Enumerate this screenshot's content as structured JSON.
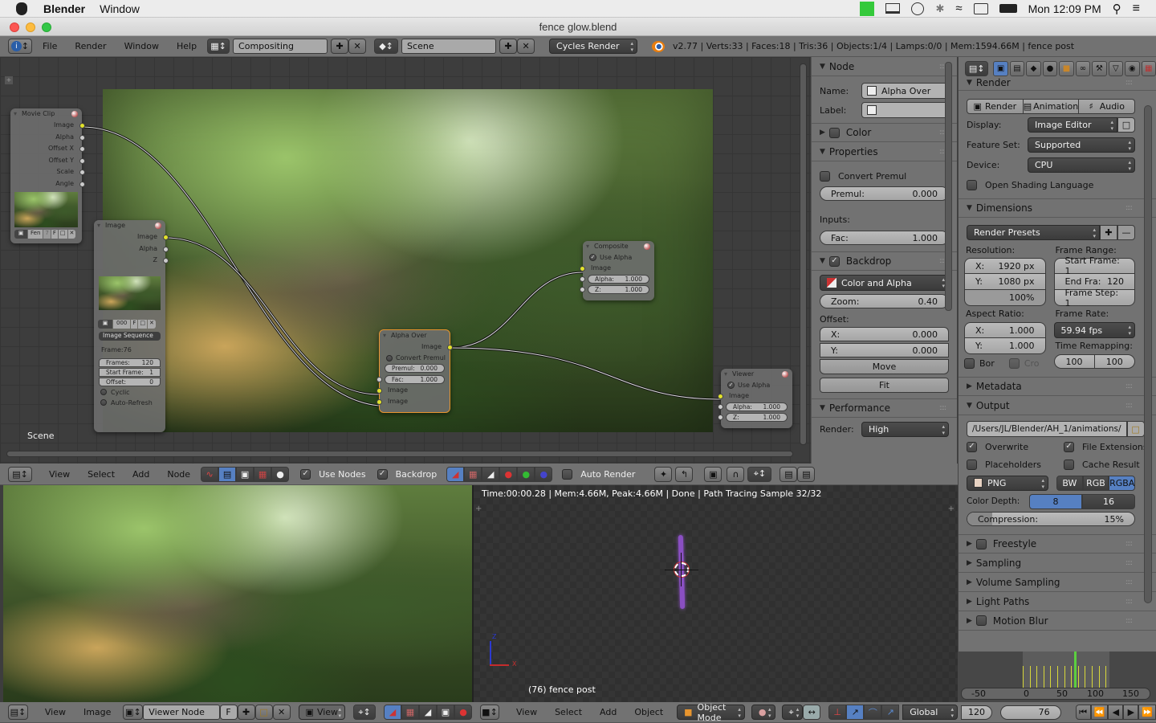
{
  "macos_menubar": {
    "app_name": "Blender",
    "menus": [
      "Window"
    ],
    "clock": "Mon 12:09 PM",
    "status_icons": [
      "app-status-icon",
      "airplay-icon",
      "time-machine-icon",
      "bluetooth-icon",
      "wifi-icon",
      "keyboard-viewer-icon",
      "battery-icon",
      "spotlight-icon",
      "notification-center-icon"
    ]
  },
  "window": {
    "title": "fence glow.blend"
  },
  "info_header": {
    "menus": [
      "File",
      "Render",
      "Window",
      "Help"
    ],
    "screen_layout": "Compositing",
    "scene": "Scene",
    "render_engine": "Cycles Render",
    "stats": "v2.77 | Verts:33 | Faces:18 | Tris:36 | Objects:1/4 | Lamps:0/0 | Mem:1594.66M | fence post"
  },
  "node_editor": {
    "scene_label": "Scene",
    "nodes": {
      "movie_clip": {
        "title": "Movie Clip",
        "outputs": [
          "Image",
          "Alpha",
          "Offset X",
          "Offset Y",
          "Scale",
          "Angle"
        ],
        "clip_name": "Fen",
        "users": "7",
        "fake_user": "F"
      },
      "image": {
        "title": "Image",
        "outputs": [
          "Image",
          "Alpha",
          "Z"
        ],
        "image_name": "000",
        "fake_user": "F",
        "source": "Image Sequence",
        "frame_info": "Frame:76",
        "frames_label": "Frames:",
        "frames_value": "120",
        "start_label": "Start Frame:",
        "start_value": "1",
        "offset_label": "Offset:",
        "offset_value": "0",
        "cyclic": "Cyclic",
        "auto_refresh": "Auto-Refresh"
      },
      "alpha_over": {
        "title": "Alpha Over",
        "output": "Image",
        "convert_premul": "Convert Premul",
        "premul_label": "Premul:",
        "premul_value": "0.000",
        "fac_label": "Fac:",
        "fac_value": "1.000",
        "inputs": [
          "Image",
          "Image"
        ]
      },
      "composite": {
        "title": "Composite",
        "use_alpha": "Use Alpha",
        "input": "Image",
        "alpha_label": "Alpha:",
        "alpha_value": "1.000",
        "z_label": "Z:",
        "z_value": "1.000"
      },
      "viewer": {
        "title": "Viewer",
        "use_alpha": "Use Alpha",
        "input": "Image",
        "alpha_label": "Alpha:",
        "alpha_value": "1.000",
        "z_label": "Z:",
        "z_value": "1.000"
      }
    },
    "header": {
      "menus": [
        "View",
        "Select",
        "Add",
        "Node"
      ],
      "use_nodes_label": "Use Nodes",
      "use_nodes_checked": true,
      "backdrop_label": "Backdrop",
      "backdrop_checked": true,
      "auto_render_label": "Auto Render",
      "auto_render_checked": false
    }
  },
  "node_panel": {
    "node_section": "Node",
    "name_label": "Name:",
    "name_value": "Alpha Over",
    "label_label": "Label:",
    "label_value": "",
    "color_section": "Color",
    "properties_section": "Properties",
    "convert_premul": "Convert Premul",
    "premul_label": "Premul:",
    "premul_value": "0.000",
    "inputs_label": "Inputs:",
    "fac_label": "Fac:",
    "fac_value": "1.000",
    "backdrop_section": "Backdrop",
    "backdrop_channels": "Color and Alpha",
    "zoom_label": "Zoom:",
    "zoom_value": "0.40",
    "offset_label": "Offset:",
    "offset_x_label": "X:",
    "offset_x_value": "0.000",
    "offset_y_label": "Y:",
    "offset_y_value": "0.000",
    "move_button": "Move",
    "fit_button": "Fit",
    "performance_section": "Performance",
    "render_label": "Render:",
    "render_value": "High"
  },
  "properties": {
    "render_section": "Render",
    "render_button": "Render",
    "animation_button": "Animation",
    "audio_button": "Audio",
    "display_label": "Display:",
    "display_value": "Image Editor",
    "feature_set_label": "Feature Set:",
    "feature_set_value": "Supported",
    "device_label": "Device:",
    "device_value": "CPU",
    "osl_label": "Open Shading Language",
    "dimensions_section": "Dimensions",
    "render_presets": "Render Presets",
    "resolution_label": "Resolution:",
    "res_x_label": "X:",
    "res_x_value": "1920 px",
    "res_y_label": "Y:",
    "res_y_value": "1080 px",
    "res_percent": "100%",
    "frame_range_label": "Frame Range:",
    "start_frame": "Start Frame: 1",
    "end_frame_label": "End Fra:",
    "end_frame_value": "120",
    "frame_step": "Frame Step: 1",
    "aspect_label": "Aspect Ratio:",
    "aspect_x_label": "X:",
    "aspect_x_value": "1.000",
    "aspect_y_label": "Y:",
    "aspect_y_value": "1.000",
    "border_label": "Bor",
    "crop_label": "Cro",
    "frame_rate_label": "Frame Rate:",
    "frame_rate_value": "59.94 fps",
    "time_remap_label": "Time Remapping:",
    "time_remap_old": "100",
    "time_remap_new": "100",
    "metadata_section": "Metadata",
    "output_section": "Output",
    "output_path": "/Users/JL/Blender/AH_1/animations/",
    "overwrite": "Overwrite",
    "file_extensions": "File Extensions",
    "placeholders": "Placeholders",
    "cache_result": "Cache Result",
    "file_format": "PNG",
    "color_modes": [
      "BW",
      "RGB",
      "RGBA"
    ],
    "color_mode_active": "RGBA",
    "color_depth_label": "Color Depth:",
    "color_depths": [
      "8",
      "16"
    ],
    "color_depth_active": "8",
    "compression_label": "Compression:",
    "compression_value": "15%",
    "compression_fraction": 0.15,
    "collapsed_sections": [
      "Freestyle",
      "Sampling",
      "Volume Sampling",
      "Light Paths",
      "Motion Blur"
    ]
  },
  "image_editor": {
    "menus": [
      "View",
      "Image"
    ],
    "image_name": "Viewer Node",
    "fake_user": "F",
    "view_mode": "View"
  },
  "viewport": {
    "render_info": "Time:00:00.28 | Mem:4.66M, Peak:4.66M | Done | Path Tracing Sample 32/32",
    "object_label": "(76) fence post",
    "axis_x": "X",
    "axis_z": "Z",
    "menus": [
      "View",
      "Select",
      "Add",
      "Object"
    ],
    "mode": "Object Mode",
    "orientation": "Global"
  },
  "timeline": {
    "ruler_ticks": [
      "-50",
      "0",
      "50",
      "100",
      "150"
    ],
    "end_frame": "120",
    "current_frame": "76"
  },
  "colors": {
    "accent_blue": "#5680c2",
    "socket_yellow": "#e2e22a",
    "active_node_border": "#e8952e",
    "current_frame_green": "#5ccf3f",
    "keyframe_yellow": "#d8d83a",
    "glow_purple": "#8a4fc2"
  }
}
